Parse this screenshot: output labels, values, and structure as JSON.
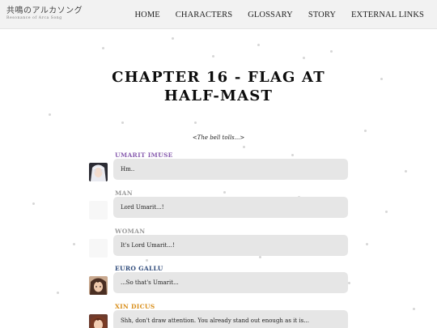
{
  "site": {
    "logo_text": "共鳴のアルカソング",
    "logo_subtitle": "Resonance of Arca Song"
  },
  "nav": {
    "items": [
      {
        "label": "HOME"
      },
      {
        "label": "CHARACTERS"
      },
      {
        "label": "GLOSSARY"
      },
      {
        "label": "STORY"
      },
      {
        "label": "EXTERNAL LINKS"
      }
    ]
  },
  "chapter": {
    "title": "CHAPTER 16 - FLAG AT HALF-MAST",
    "intro": "<The bell tolls...>"
  },
  "colors": {
    "umarit": "#8a5fb0",
    "generic": "#9a9a9a",
    "euro": "#2e4a7a",
    "xin": "#d98e1a"
  },
  "messages": [
    {
      "speaker": "UMARIT IMUSE",
      "text": "Hm..",
      "avatar": "umarit-portrait"
    },
    {
      "speaker": "MAN",
      "text": "Lord Umarit...!",
      "avatar": "blank"
    },
    {
      "speaker": "WOMAN",
      "text": "It's Lord Umarit...!",
      "avatar": "blank"
    },
    {
      "speaker": "EURO GALLU",
      "text": "...So that's Umarit...",
      "avatar": "euro-portrait"
    },
    {
      "speaker": "XIN DICUS",
      "text": "Shh, don't draw attention. You already stand out enough as it is...",
      "avatar": "xin-portrait"
    }
  ]
}
